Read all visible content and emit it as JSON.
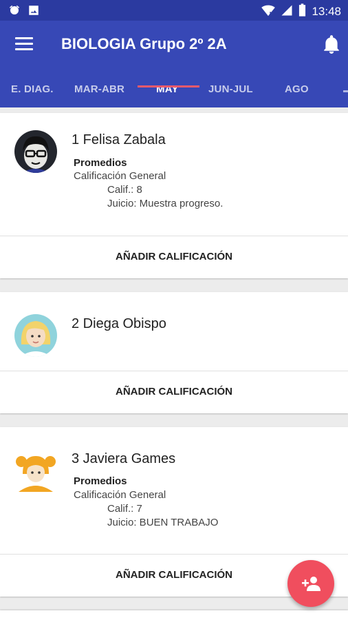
{
  "status_bar": {
    "time": "13:48",
    "left_icons": [
      "alarm-icon",
      "image-icon"
    ],
    "right_icons": [
      "wifi-icon",
      "signal-icon",
      "battery-icon"
    ]
  },
  "app_bar": {
    "title": "BIOLOGIA Grupo 2º 2A",
    "menu_icon": "menu-icon",
    "notification_icon": "bell-icon",
    "color": "#3748b6"
  },
  "tabs": [
    {
      "label": "E. DIAG.",
      "active": false
    },
    {
      "label": "MAR-ABR",
      "active": false
    },
    {
      "label": "MAY",
      "active": true
    },
    {
      "label": "JUN-JUL",
      "active": false
    },
    {
      "label": "AGO",
      "active": false
    }
  ],
  "tab_indicator_color": "#ef5a6b",
  "students": [
    {
      "name": "1 Felisa Zabala",
      "avatar": "man-glasses-avatar",
      "promedios_title": "Promedios",
      "calificacion": "Calificación General",
      "calif": "Calif.: 8",
      "juicio": "Juicio: Muestra progreso.",
      "action": "AÑADIR CALIFICACIÓN"
    },
    {
      "name": "2 Diega Obispo",
      "avatar": "woman-blonde-avatar",
      "action": "AÑADIR CALIFICACIÓN"
    },
    {
      "name": "3 Javiera Games",
      "avatar": "girl-pigtails-avatar",
      "promedios_title": "Promedios",
      "calificacion": "Calificación General",
      "calif": "Calif.: 7",
      "juicio": "Juicio: BUEN TRABAJO",
      "action": "AÑADIR CALIFICACIÓN"
    }
  ],
  "fab": {
    "icon": "add-group-icon",
    "color": "#f04e5e"
  }
}
